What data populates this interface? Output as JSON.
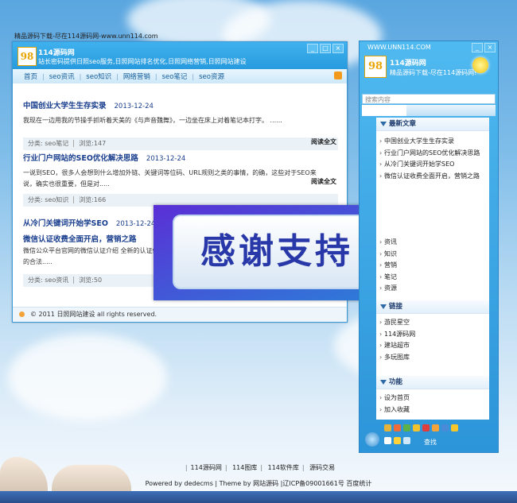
{
  "page": {
    "top_note": "精品源码下载-尽在114源码网-www.unn114.com"
  },
  "window": {
    "title": "114源码网",
    "subtitle": "站长密码提供日照seo服务,日照网站排名优化,日照网络营销,日照网站建设",
    "buttons": [
      "_",
      "□",
      "×"
    ],
    "nav": [
      "首页",
      "seo资讯",
      "seo知识",
      "网络营销",
      "seo笔记",
      "seo资源"
    ],
    "footer": "© 2011 日照网站建设 all rights reserved."
  },
  "posts": [
    {
      "title": "中国创业大学生生存实录",
      "date": "2013-12-24",
      "body": "我现在一边用我的节操手抓听着天美的《与声音魏舞》，一边坐在床上对着笔记本打字。 ......",
      "more": "阅读全文",
      "category": "分类: seo笔记",
      "views": "浏览:147"
    },
    {
      "title": "行业门户网站的SEO优化解决思路",
      "date": "2013-12-24",
      "body": "一说到SEO，很多人会想到什么增加外链、关键词等位码、URL规则之类的事情，的确，这些对于SEO来说，确实也很重要，但是对.....",
      "more": "阅读全文",
      "category": "分类: seo知识",
      "views": "浏览:166"
    },
    {
      "title": "从冷门关键词开始学SEO",
      "date": "2013-12-24"
    },
    {
      "title": "微信认证收费全面开启，营销之路",
      "body": "微信公众平台官网的微信认证介绍 全新的认证体系",
      "body2": "的合法.....",
      "category": "分类: seo资讯",
      "views": "浏览:50"
    }
  ],
  "overlay": {
    "text": "感谢支持"
  },
  "side_panel": {
    "url": "WWW.UNN114.COM",
    "name": "114源码网",
    "subtitle": "精品源码下载-尽在114源码网!",
    "search_placeholder": "搜索内容",
    "latest_title": "最新文章",
    "latest": [
      "中国创业大学生生存实录",
      "行业门户网站的SEO优化解决思路",
      "从冷门关键词开始学SEO",
      "微信认证收费全面开启，营销之路"
    ],
    "categories": [
      "资讯",
      "知识",
      "营销",
      "笔记",
      "资源"
    ],
    "links_title": "链接",
    "links": [
      "游民星空",
      "114源码网",
      "建站超市",
      "多玩图库"
    ],
    "func_title": "功能",
    "functions": [
      "设为首页",
      "加入收藏"
    ],
    "find_label": "查找"
  },
  "footer": {
    "links": [
      "114源码网",
      "114图库",
      "114软件库",
      "源码交易"
    ],
    "copyright": "Powered by dedecms | Theme by 网站源码 |辽ICP备09001661号 百度统计"
  }
}
